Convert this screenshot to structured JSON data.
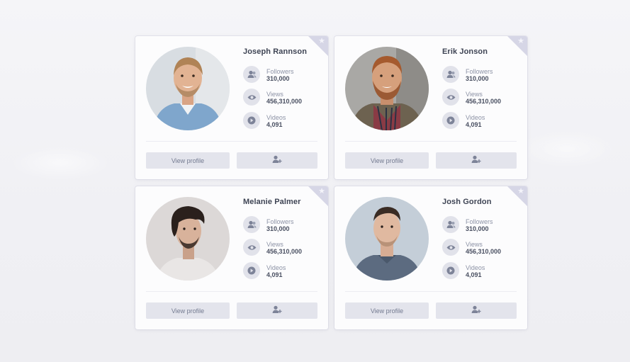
{
  "colors": {
    "page_bg": "#f1f1f5",
    "card_bg": "#fcfcfd",
    "button_bg": "#e3e4ec",
    "icon_bg": "#e1e2ea",
    "icon_fg": "#7d8398",
    "corner": "#d6d6e6",
    "name_text": "#3e4454"
  },
  "icons": {
    "followers": "users-icon",
    "views": "eye-icon",
    "videos": "play-icon",
    "favorite": "star-icon",
    "add_user": "user-plus-icon"
  },
  "profiles": [
    {
      "name": "Joseph Rannson",
      "followers_label": "Followers",
      "followers": "310,000",
      "views_label": "Views",
      "views": "456,310,000",
      "videos_label": "Videos",
      "videos": "4,091",
      "view_profile_label": "View profile"
    },
    {
      "name": "Erik Jonson",
      "followers_label": "Followers",
      "followers": "310,000",
      "views_label": "Views",
      "views": "456,310,000",
      "videos_label": "Videos",
      "videos": "4,091",
      "view_profile_label": "View profile"
    },
    {
      "name": "Melanie Palmer",
      "followers_label": "Followers",
      "followers": "310,000",
      "views_label": "Views",
      "views": "456,310,000",
      "videos_label": "Videos",
      "videos": "4,091",
      "view_profile_label": "View profile"
    },
    {
      "name": "Josh Gordon",
      "followers_label": "Followers",
      "followers": "310,000",
      "views_label": "Views",
      "views": "456,310,000",
      "videos_label": "Videos",
      "videos": "4,091",
      "view_profile_label": "View profile"
    }
  ]
}
